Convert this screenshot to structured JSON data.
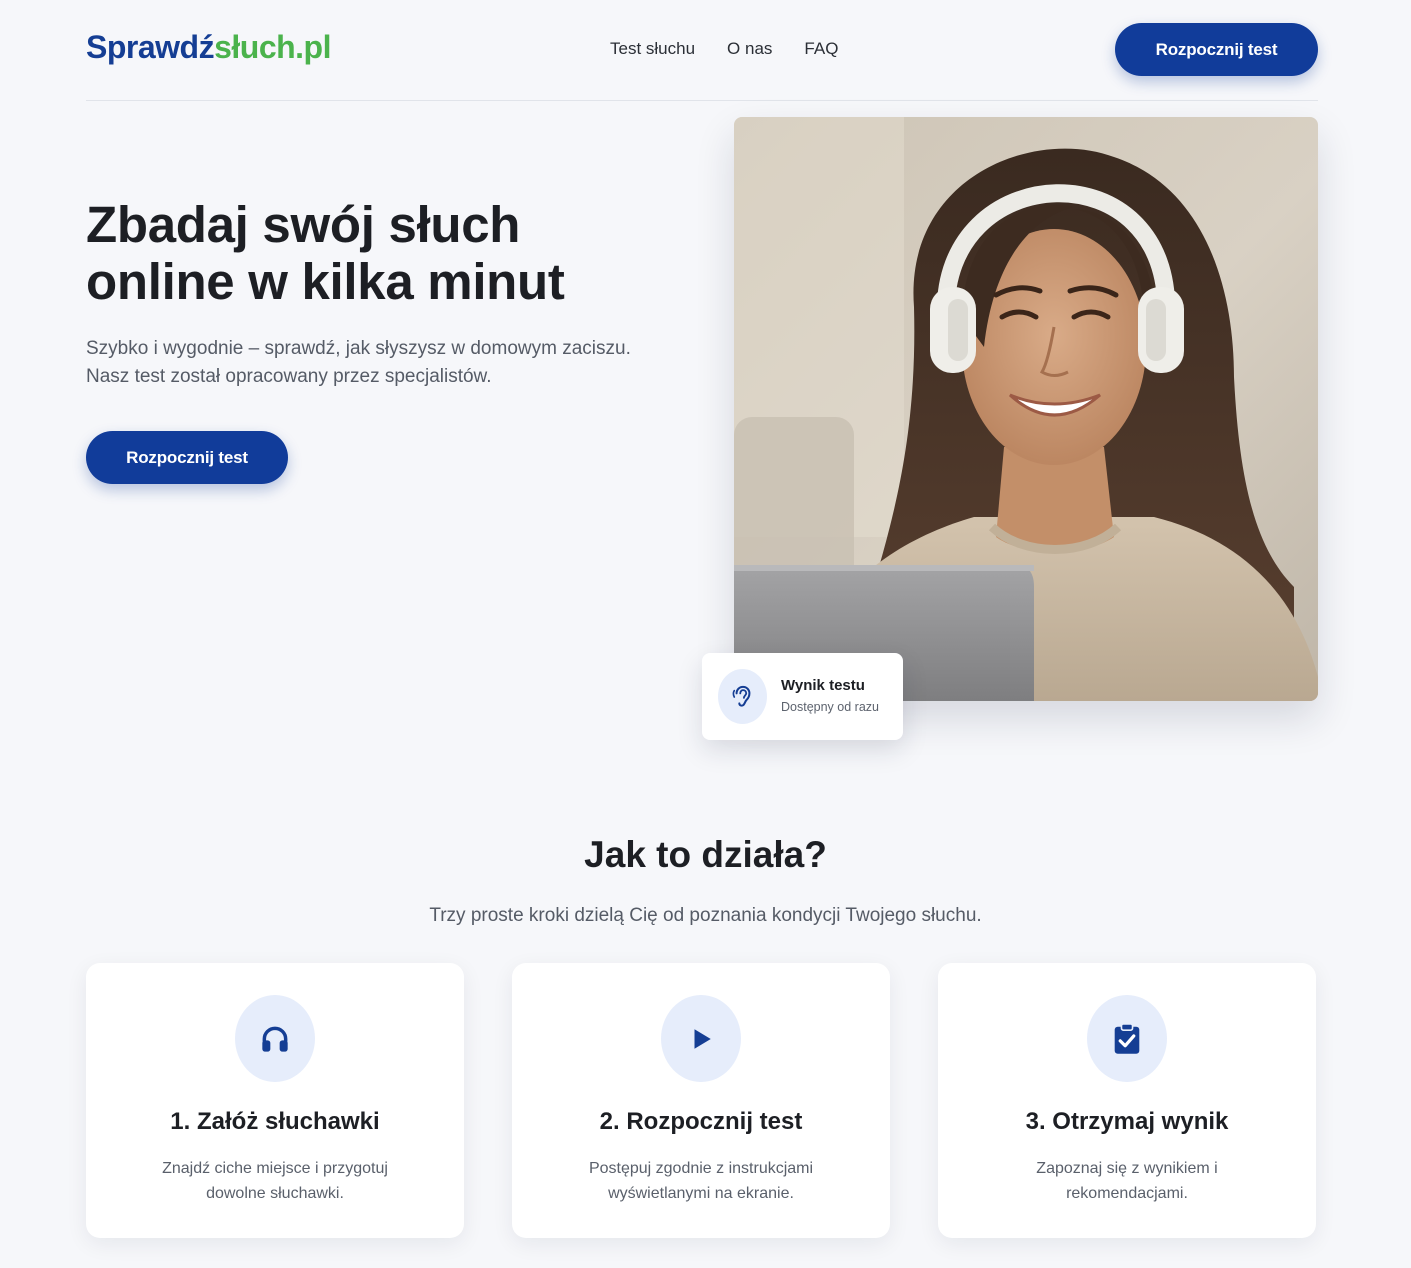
{
  "header": {
    "logo_part1": "Sprawdź",
    "logo_part2": "słuch.pl",
    "nav": [
      "Test słuchu",
      "O nas",
      "FAQ"
    ],
    "cta_label": "Rozpocznij test"
  },
  "hero": {
    "title_line1": "Zbadaj swój słuch",
    "title_line2": "online w kilka minut",
    "subtitle_line1": "Szybko i wygodnie – sprawdź, jak słyszysz w domowym zaciszu.",
    "subtitle_line2": "Nasz test został opracowany przez specjalistów.",
    "cta_label": "Rozpocznij test",
    "image_icon": "woman-with-headphones-photo",
    "result_card": {
      "icon": "ear-icon",
      "title": "Wynik testu",
      "subtitle": "Dostępny od razu"
    }
  },
  "how_it_works": {
    "title": "Jak to działa?",
    "subtitle": "Trzy proste kroki dzielą Cię od poznania kondycji Twojego słuchu.",
    "steps": [
      {
        "icon": "headphones-icon",
        "title": "1. Załóż słuchawki",
        "text_line1": "Znajdź ciche miejsce i przygotuj",
        "text_line2": "dowolne słuchawki."
      },
      {
        "icon": "play-icon",
        "title": "2. Rozpocznij test",
        "text_line1": "Postępuj zgodnie z instrukcjami",
        "text_line2": "wyświetlanymi na ekranie."
      },
      {
        "icon": "clipboard-check-icon",
        "title": "3. Otrzymaj wynik",
        "text_line1": "Zapoznaj się z wynikiem i",
        "text_line2": "rekomendacjami."
      }
    ]
  },
  "colors": {
    "primary": "#113c9a",
    "logo_blue": "#153e94",
    "logo_green": "#4bb34c",
    "icon_bg": "#e6edfb",
    "page_bg": "#f6f7fa"
  }
}
